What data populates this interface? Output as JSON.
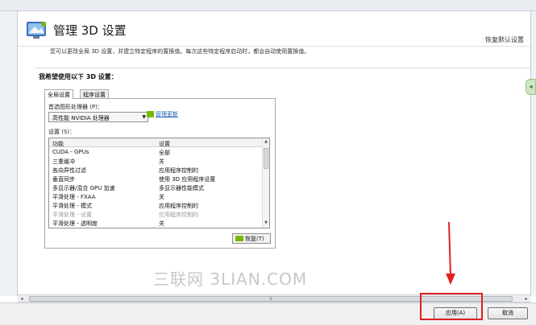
{
  "header": {
    "title": "管理 3D 设置",
    "restore_defaults": "恢复默认设置",
    "subtitle": "您可以更改全局 3D 设置，并建立特定程序的置换值。每次这些特定程序启动时，都会自动使用置换值。"
  },
  "panel": {
    "title": "我希望使用以下 3D 设置：",
    "tabs": [
      {
        "label": "全局设置",
        "active": true
      },
      {
        "label": "程序设置",
        "active": false
      }
    ],
    "preferred_gpu_label": "首选图形处理器 (P)：",
    "preferred_gpu_value": "高性能 NVIDIA 处理器",
    "manage_link": "管理更新",
    "settings_label": "设置 (S)：",
    "columns": {
      "feature": "功能",
      "setting": "设置"
    },
    "rows": [
      {
        "feature": "CUDA - GPUs",
        "setting": "全部",
        "dim": false
      },
      {
        "feature": "三重缓冲",
        "setting": "关",
        "dim": false
      },
      {
        "feature": "各向异性过滤",
        "setting": "应用程序控制的",
        "dim": false
      },
      {
        "feature": "垂直同步",
        "setting": "使用 3D 应用程序设置",
        "dim": false
      },
      {
        "feature": "多显示器/混合 GPU 加速",
        "setting": "多显示器性能模式",
        "dim": false
      },
      {
        "feature": "平滑处理 - FXAA",
        "setting": "关",
        "dim": false
      },
      {
        "feature": "平滑处理 - 模式",
        "setting": "应用程序控制的",
        "dim": false
      },
      {
        "feature": "平滑处理 - 设置",
        "setting": "应用程序控制的",
        "dim": true
      },
      {
        "feature": "平滑处理 - 透明度",
        "setting": "关",
        "dim": false
      }
    ],
    "restore_button": "恢复(T)"
  },
  "watermark": "三联网 3LIAN.COM",
  "footer": {
    "apply": "应用(A)",
    "cancel": "取消"
  },
  "colors": {
    "nvidia_green": "#76b900",
    "annotation_red": "#e02020",
    "link_blue": "#1d5fb8"
  },
  "icons": {
    "header": "nvidia-3d-settings-icon",
    "scroll_up": "scroll-up-arrow-icon",
    "scroll_down": "scroll-down-arrow-icon"
  }
}
